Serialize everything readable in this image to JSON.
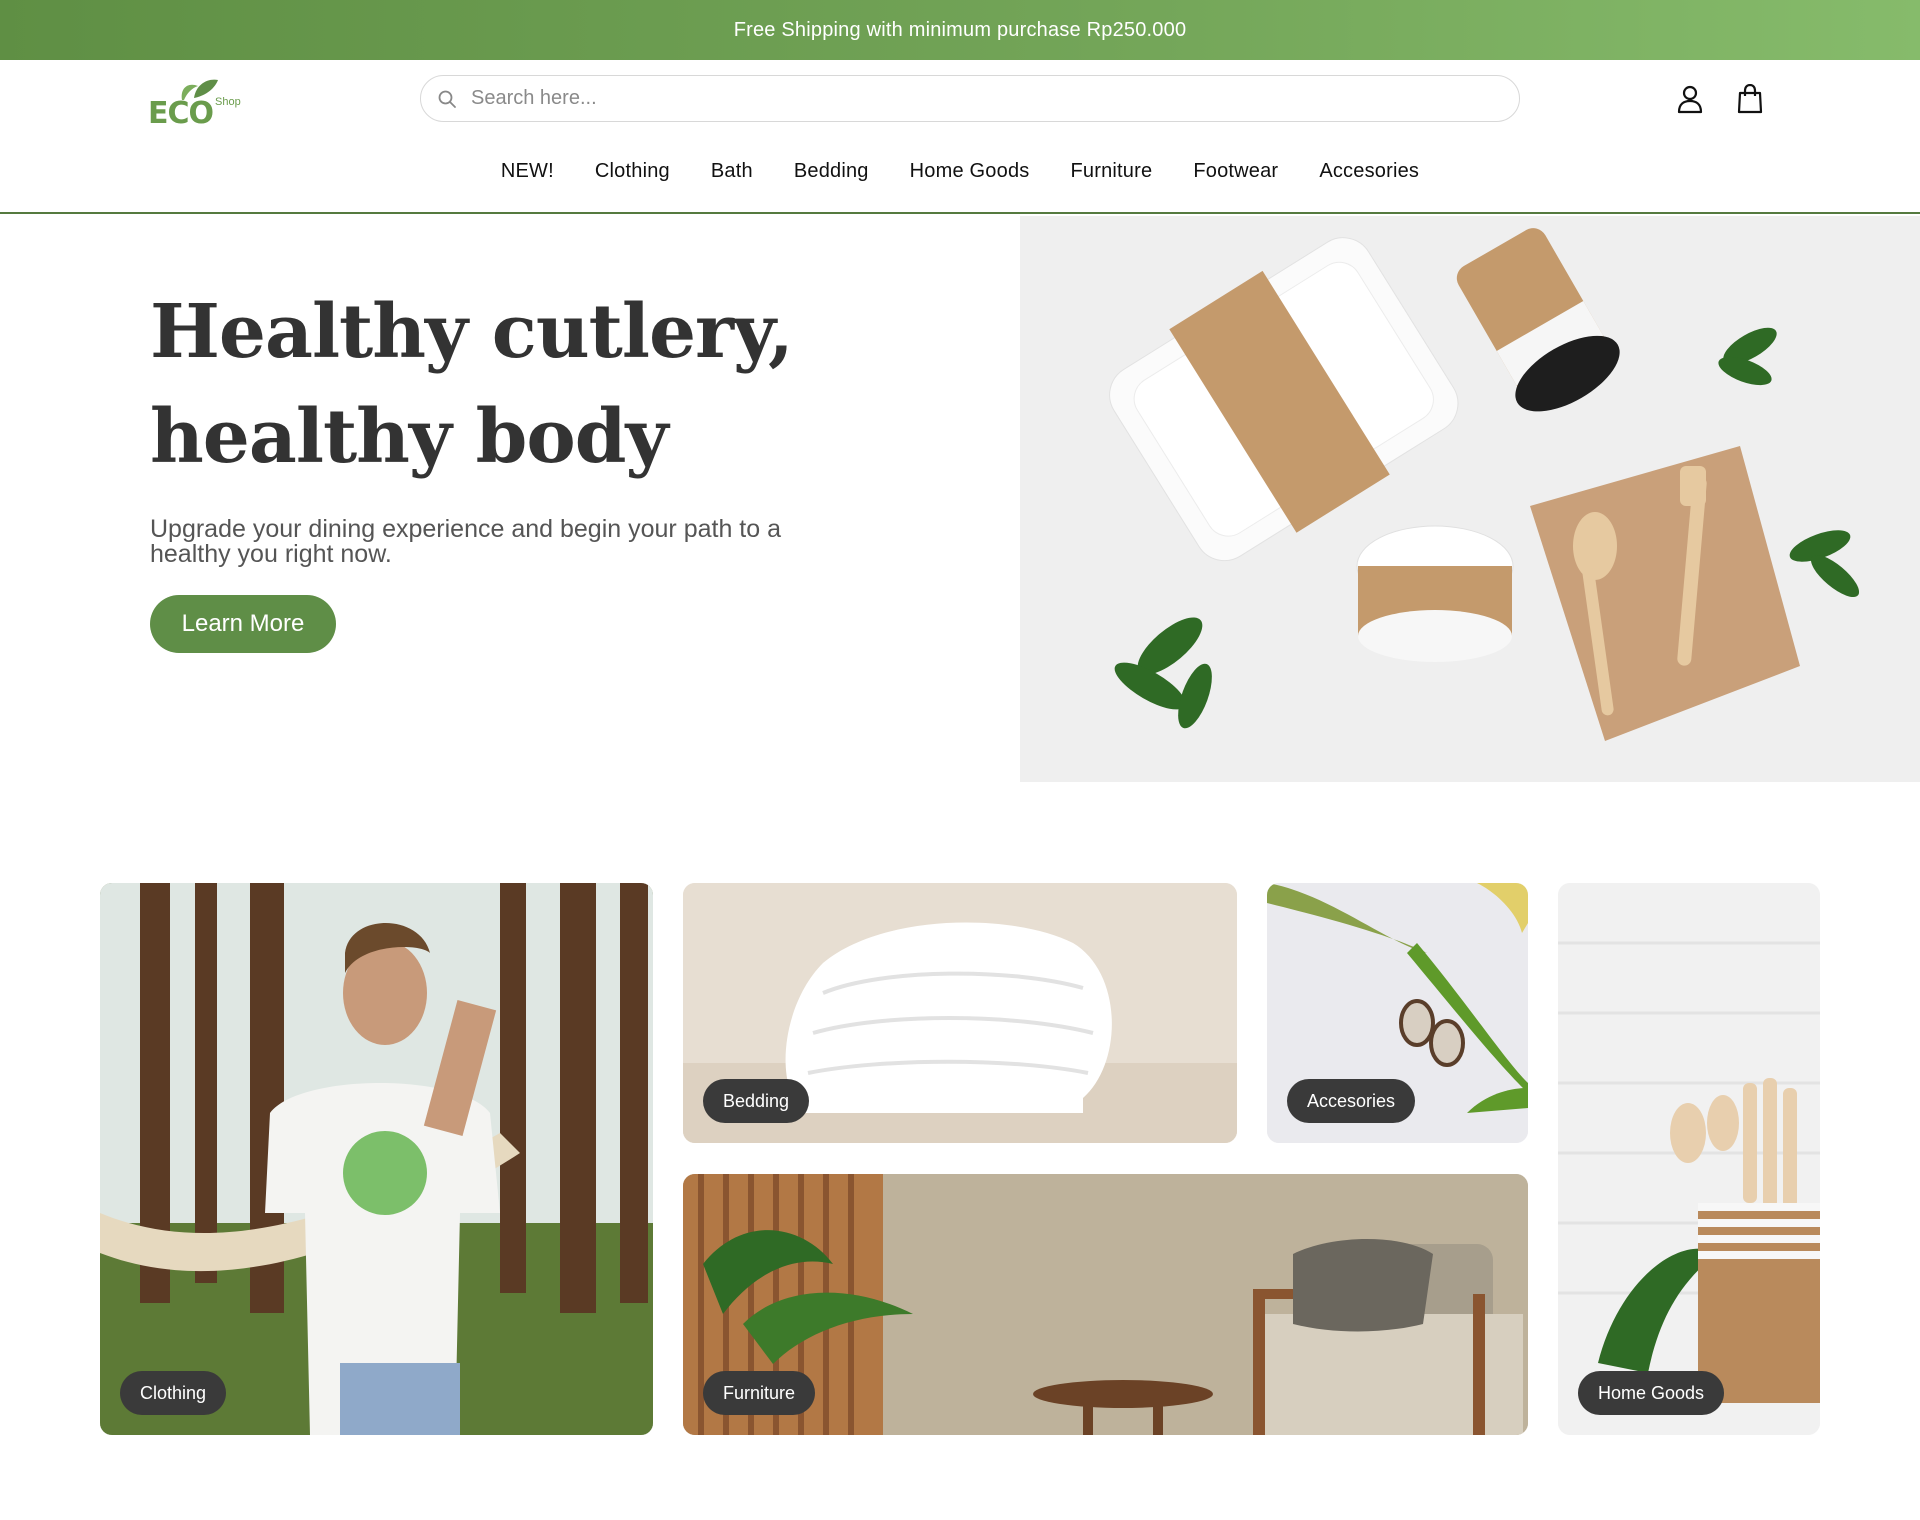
{
  "banner": {
    "text": "Free Shipping with minimum purchase Rp250.000"
  },
  "logo": {
    "main": "ECO",
    "sub": "Shop"
  },
  "search": {
    "placeholder": "Search here..."
  },
  "nav": [
    "NEW!",
    "Clothing",
    "Bath",
    "Bedding",
    "Home Goods",
    "Furniture",
    "Footwear",
    "Accesories"
  ],
  "hero": {
    "title": "Healthy cutlery,\nhealthy body",
    "subtitle": "Upgrade your dining experience and begin your path to a healthy you right now.",
    "button": "Learn More"
  },
  "categories": {
    "clothing": "Clothing",
    "bedding": "Bedding",
    "accesories": "Accesories",
    "home_goods": "Home Goods",
    "furniture": "Furniture"
  },
  "colors": {
    "brand": "#5f8e47",
    "banner": "#74a659",
    "pill": "#3a3a3a"
  },
  "icons": [
    "search-icon",
    "user-icon",
    "shopping-bag-icon"
  ]
}
